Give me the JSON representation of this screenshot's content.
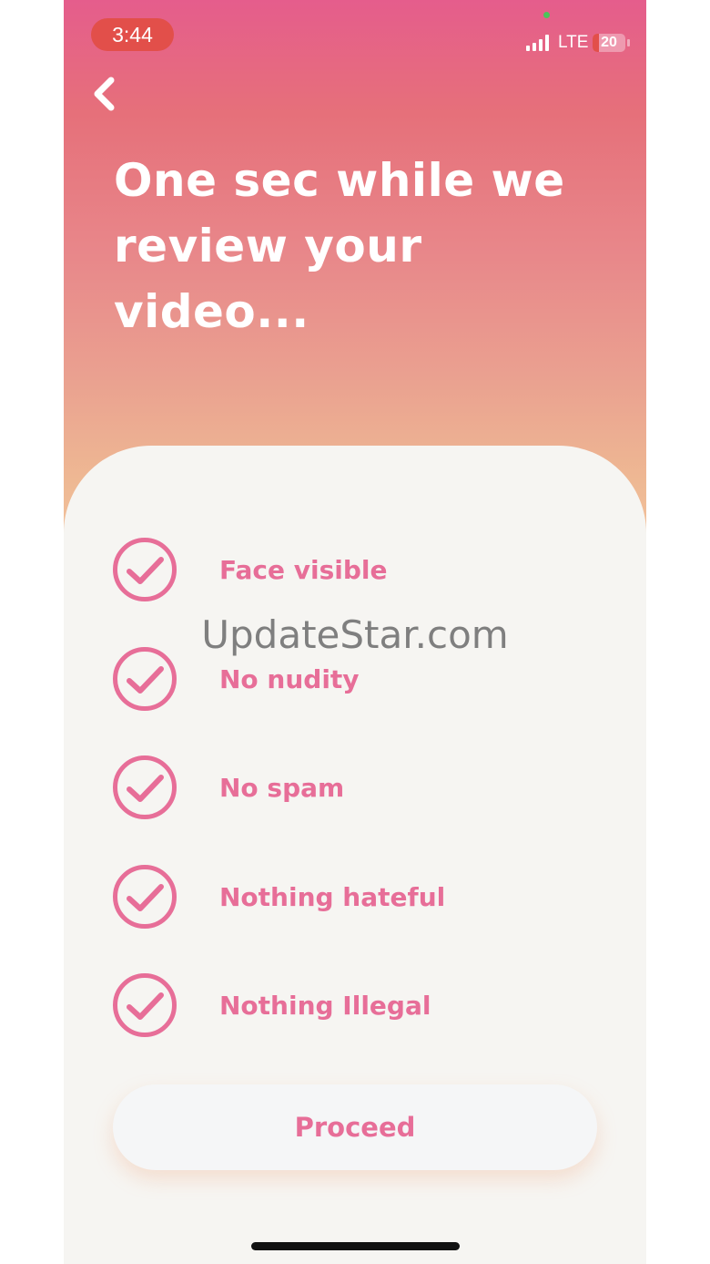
{
  "status_bar": {
    "time": "3:44",
    "network": "LTE",
    "battery_level": "20",
    "battery_fraction": 0.2,
    "signal_bars_filled": 4
  },
  "header": {
    "back_icon": "chevron-left-icon",
    "title": "One sec while we review your video..."
  },
  "checklist": {
    "icon": "check-circle-icon",
    "items": [
      {
        "label": "Face visible"
      },
      {
        "label": "No nudity"
      },
      {
        "label": "No spam"
      },
      {
        "label": "Nothing hateful"
      },
      {
        "label": "Nothing Illegal"
      }
    ]
  },
  "watermark": "UpdateStar.com",
  "proceed_button": {
    "label": "Proceed"
  },
  "colors": {
    "accent": "#e76e98",
    "gradient_top": "#e55d8c",
    "gradient_bottom": "#f4c6a0",
    "card_background": "#f6f5f2",
    "time_pill": "#e24f4a"
  }
}
